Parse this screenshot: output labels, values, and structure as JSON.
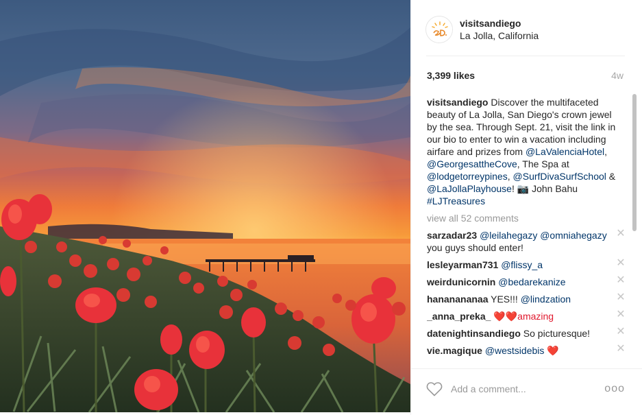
{
  "post": {
    "username": "visitsandiego",
    "location": "La Jolla, California",
    "likes": "3,399 likes",
    "age": "4w",
    "avatar_icon": "san-diego-logo-icon",
    "photo_alt": "Photo by visitsandiego"
  },
  "caption": {
    "username": "visitsandiego",
    "text_1": " Discover the multifaceted beauty of La Jolla, San Diego's crown jewel by the sea. Through Sept. 21, visit the link in our bio to enter to win a vacation including airfare and prizes from ",
    "mention_1": "@LaValenciaHotel",
    "text_2": ", ",
    "mention_2": "@GeorgesattheCove",
    "text_3": ", The Spa at ",
    "mention_3": "@lodgetorreypines",
    "text_4": ", ",
    "mention_4": "@SurfDivaSurfSchool",
    "text_5": " & ",
    "mention_5": "@LaJollaPlayhouse",
    "text_6": "! 📷 John Bahu ",
    "hashtag": "#LJTreasures"
  },
  "view_all": "view all 52 comments",
  "comments": [
    {
      "user": "sarzadar23",
      "mention": "@leilahegazy @omniahegazy",
      "text": " you guys should enter!"
    },
    {
      "user": "lesleyarman731",
      "mention": "@flissy_a",
      "text": ""
    },
    {
      "user": "weirdunicornin",
      "mention": "@bedarekanize",
      "text": ""
    },
    {
      "user": "hananananaa",
      "mention": "@lindzation",
      "text": "YES!!! "
    },
    {
      "user": "_anna_preka_",
      "mention": "",
      "text": " ❤️❤️amazing"
    },
    {
      "user": "datenightinsandiego",
      "mention": "",
      "text": "So picturesque!"
    },
    {
      "user": "vie.magique",
      "mention": "@westsidebis",
      "text": " ❤️"
    }
  ],
  "footer": {
    "comment_placeholder": "Add a comment...",
    "more_label": "ooo"
  },
  "colors": {
    "mention": "#003569",
    "muted": "#999999",
    "text": "#262626"
  }
}
